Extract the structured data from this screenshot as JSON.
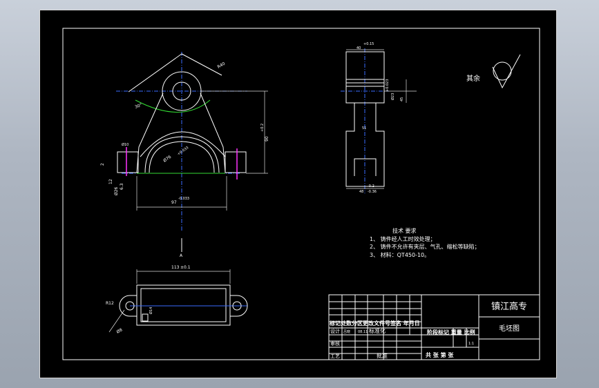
{
  "front_view": {
    "dim_radius": "R40",
    "dim_angle": "30°",
    "dim_bore": "Ø76",
    "dim_bore_tol": "+0.033",
    "dim_height": "90",
    "dim_height_tol": "+0.2",
    "dim_width": "97",
    "dim_width_tol": "-0.033",
    "dim_gap": "2",
    "dim_r3": "Ø26",
    "dim_r3b": "6.3",
    "dim_depth": "12",
    "dim_small": "Ø10",
    "section_mark": "A"
  },
  "side_view": {
    "dim_top": "40",
    "dim_top_tol": "+0.15",
    "dim_mid": "Ø23",
    "dim_mid_tol": "+0.023",
    "dim_right": "45",
    "dim_center": "51",
    "dim_bottom": "48",
    "dim_bottom_tol": "-0.36",
    "dim_bottom_tol2": "-0.2"
  },
  "top_view": {
    "dim_length": "113",
    "dim_length_tol": "±0.1",
    "dim_radius": "R12",
    "dim_hole": "Ø8",
    "dim_inner": "Ø14"
  },
  "roughness": {
    "label": "其余"
  },
  "requirements": {
    "title": "技术 要求",
    "items": [
      "1、 铸件经人工时效处理；",
      "2、 铸件不允许有夹层、气孔、缩松等缺陷；",
      "3、 材料：QT450-10。"
    ]
  },
  "title_block": {
    "school": "镇江高专",
    "drawing_name": "毛坯图",
    "header_row": "标记处数分区更改文件号签名 年月日",
    "row_design": "设计",
    "row_check": "审核",
    "row_process": "工艺",
    "standard": "标准化",
    "approve": "批准",
    "designer": "吕晓",
    "date": "08.11",
    "stage_labels": "阶段标记 重量 比例",
    "scale": "1:1",
    "sheet_info": "共   张   第   张"
  }
}
